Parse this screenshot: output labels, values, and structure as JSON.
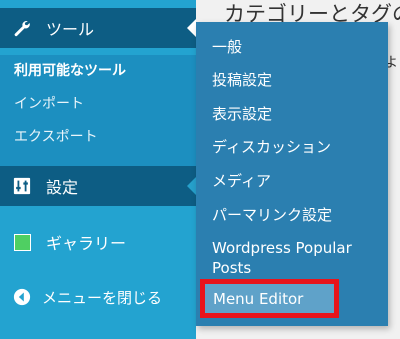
{
  "sidebar": {
    "tools": {
      "label": "ツール",
      "icon": "wrench-icon"
    },
    "tools_submenu": [
      {
        "label": "利用可能なツール",
        "current": true
      },
      {
        "label": "インポート",
        "current": false
      },
      {
        "label": "エクスポート",
        "current": false
      }
    ],
    "settings": {
      "label": "設定",
      "icon": "sliders-icon"
    },
    "gallery": {
      "label": "ギャラリー",
      "icon": "green-square-icon"
    },
    "collapse": {
      "label": "メニューを閉じる",
      "icon": "arrow-left-circle-icon"
    }
  },
  "content": {
    "page_title": "カテゴリーとタグの",
    "side_text": "よ"
  },
  "flyout": {
    "items": [
      {
        "label": "一般"
      },
      {
        "label": "投稿設定"
      },
      {
        "label": "表示設定"
      },
      {
        "label": "ディスカッション"
      },
      {
        "label": "メディア"
      },
      {
        "label": "パーマリンク設定"
      },
      {
        "label": "Wordpress Popular Posts"
      }
    ],
    "highlighted": {
      "label": "Menu Editor"
    }
  },
  "colors": {
    "sidebar_bg": "#23a3d0",
    "sidebar_active": "#0d5d84",
    "flyout_bg": "#2b7fb0",
    "highlight_border": "#e8141b",
    "gallery_swatch": "#4fcf62"
  }
}
